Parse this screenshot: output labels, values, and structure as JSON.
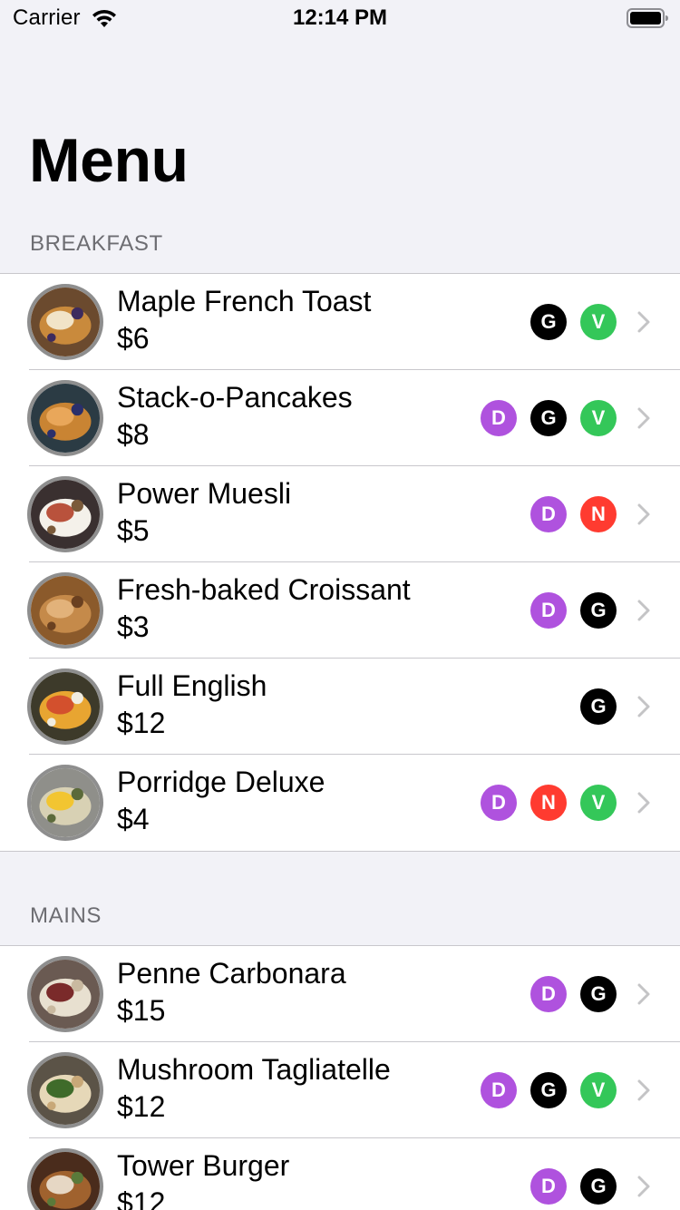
{
  "status_bar": {
    "carrier": "Carrier",
    "time": "12:14 PM"
  },
  "title": "Menu",
  "colors": {
    "D": "#af52de",
    "G": "#000000",
    "V": "#34c759",
    "N": "#ff3b30"
  },
  "sections": [
    {
      "header": "BREAKFAST",
      "items": [
        {
          "name": "Maple French Toast",
          "price": "$6",
          "badges": [
            "G",
            "V"
          ],
          "image": "french-toast-photo"
        },
        {
          "name": "Stack-o-Pancakes",
          "price": "$8",
          "badges": [
            "D",
            "G",
            "V"
          ],
          "image": "pancakes-photo"
        },
        {
          "name": "Power Muesli",
          "price": "$5",
          "badges": [
            "D",
            "N"
          ],
          "image": "muesli-photo"
        },
        {
          "name": "Fresh-baked Croissant",
          "price": "$3",
          "badges": [
            "D",
            "G"
          ],
          "image": "croissant-photo"
        },
        {
          "name": "Full English",
          "price": "$12",
          "badges": [
            "G"
          ],
          "image": "full-english-photo"
        },
        {
          "name": "Porridge Deluxe",
          "price": "$4",
          "badges": [
            "D",
            "N",
            "V"
          ],
          "image": "porridge-photo"
        }
      ]
    },
    {
      "header": "MAINS",
      "items": [
        {
          "name": "Penne Carbonara",
          "price": "$15",
          "badges": [
            "D",
            "G"
          ],
          "image": "penne-photo"
        },
        {
          "name": "Mushroom Tagliatelle",
          "price": "$12",
          "badges": [
            "D",
            "G",
            "V"
          ],
          "image": "tagliatelle-photo"
        },
        {
          "name": "Tower Burger",
          "price": "$12",
          "badges": [
            "D",
            "G"
          ],
          "image": "burger-photo"
        }
      ]
    }
  ]
}
